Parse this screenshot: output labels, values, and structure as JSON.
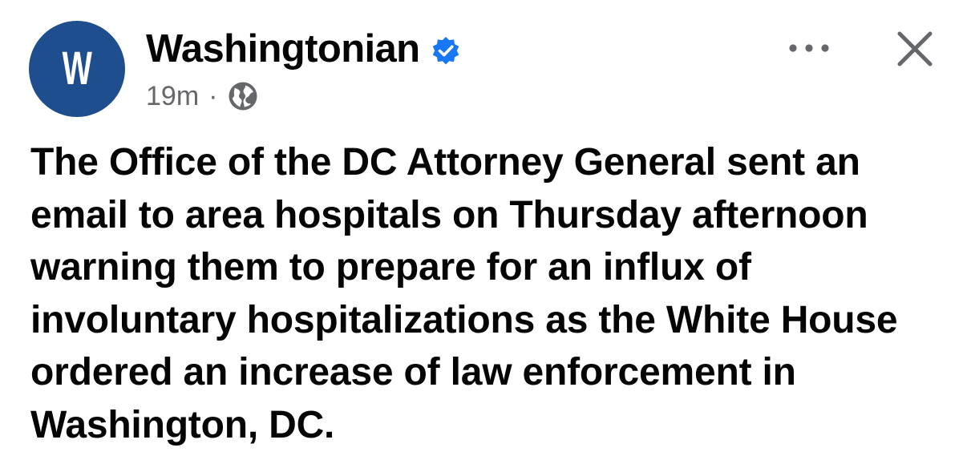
{
  "post": {
    "avatar_letter": "W",
    "page_name": "Washingtonian",
    "verified_icon": "verified-badge-icon",
    "timestamp": "19m",
    "separator": "·",
    "audience_icon": "globe-icon",
    "more_icon": "more-options-icon",
    "close_icon": "close-icon",
    "body_text": "The Office of the DC Attorney General sent an email to area hospitals on Thursday afternoon warning them to prepare for an influx of involuntary hospitalizations as the White House ordered an increase of law enforcement in Washington, DC."
  },
  "colors": {
    "avatar_background": "#1f4e8f",
    "verified_blue": "#1877f2",
    "secondary_text": "#65676b",
    "primary_text": "#050505"
  }
}
